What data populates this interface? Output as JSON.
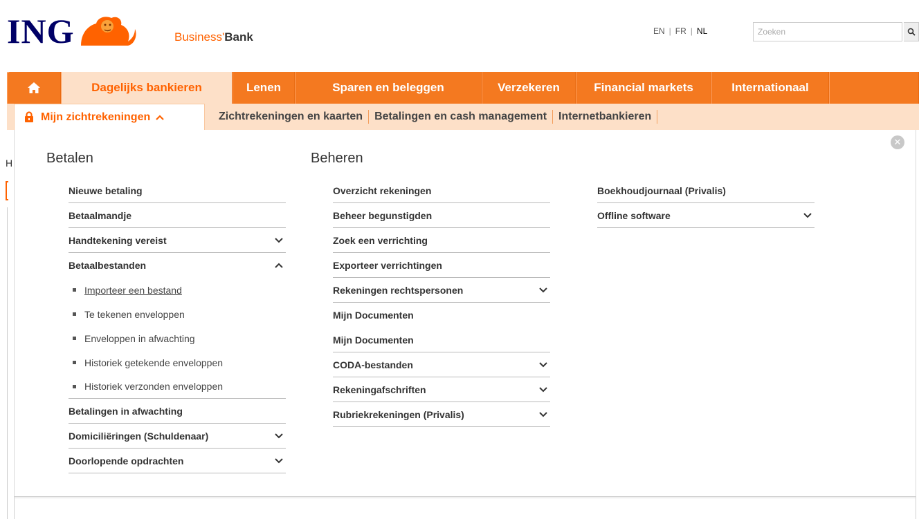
{
  "header": {
    "logo_text": "ING",
    "brand_prefix": "Business",
    "brand_apostrophe": "'",
    "brand_suffix": "Bank",
    "languages": [
      "EN",
      "FR",
      "NL"
    ],
    "language_separator": "|",
    "active_language": "NL",
    "search_placeholder": "Zoeken"
  },
  "mainnav": {
    "items": [
      "Dagelijks bankieren",
      "Lenen",
      "Sparen en beleggen",
      "Verzekeren",
      "Financial markets",
      "Internationaal"
    ],
    "active": "Dagelijks bankieren"
  },
  "subnav": {
    "active_label": "Mijn zichtrekeningen",
    "links": [
      "Zichtrekeningen en kaarten",
      "Betalingen en cash management",
      "Internetbankieren"
    ]
  },
  "page_behind": {
    "fragment": "H"
  },
  "menu": {
    "close_symbol": "✕",
    "betalen": {
      "heading": "Betalen",
      "items": [
        "Nieuwe betaling",
        "Betaalmandje",
        "Handtekening vereist",
        "Betaalbestanden",
        "Betalingen in afwachting",
        "Domiciliëringen (Schuldenaar)",
        "Doorlopende opdrachten"
      ],
      "sub_items": [
        "Importeer een bestand",
        "Te tekenen enveloppen",
        "Enveloppen in afwachting",
        "Historiek getekende enveloppen",
        "Historiek verzonden enveloppen"
      ]
    },
    "beheren": {
      "heading": "Beheren",
      "items": [
        "Overzicht rekeningen",
        "Beheer begunstigden",
        "Zoek een verrichting",
        "Exporteer verrichtingen",
        "Rekeningen rechtspersonen",
        "Mijn Documenten",
        "Mijn Documenten",
        "CODA-bestanden",
        "Rekeningafschriften",
        "Rubriekrekeningen (Privalis)"
      ]
    },
    "third": {
      "items": [
        "Boekhoudjournaal (Privalis)",
        "Offline software"
      ]
    }
  },
  "colors": {
    "orange": "#ff6200",
    "nav_orange": "#f47920",
    "subnav_bg": "#fde0c8",
    "ing_blue": "#000066"
  }
}
